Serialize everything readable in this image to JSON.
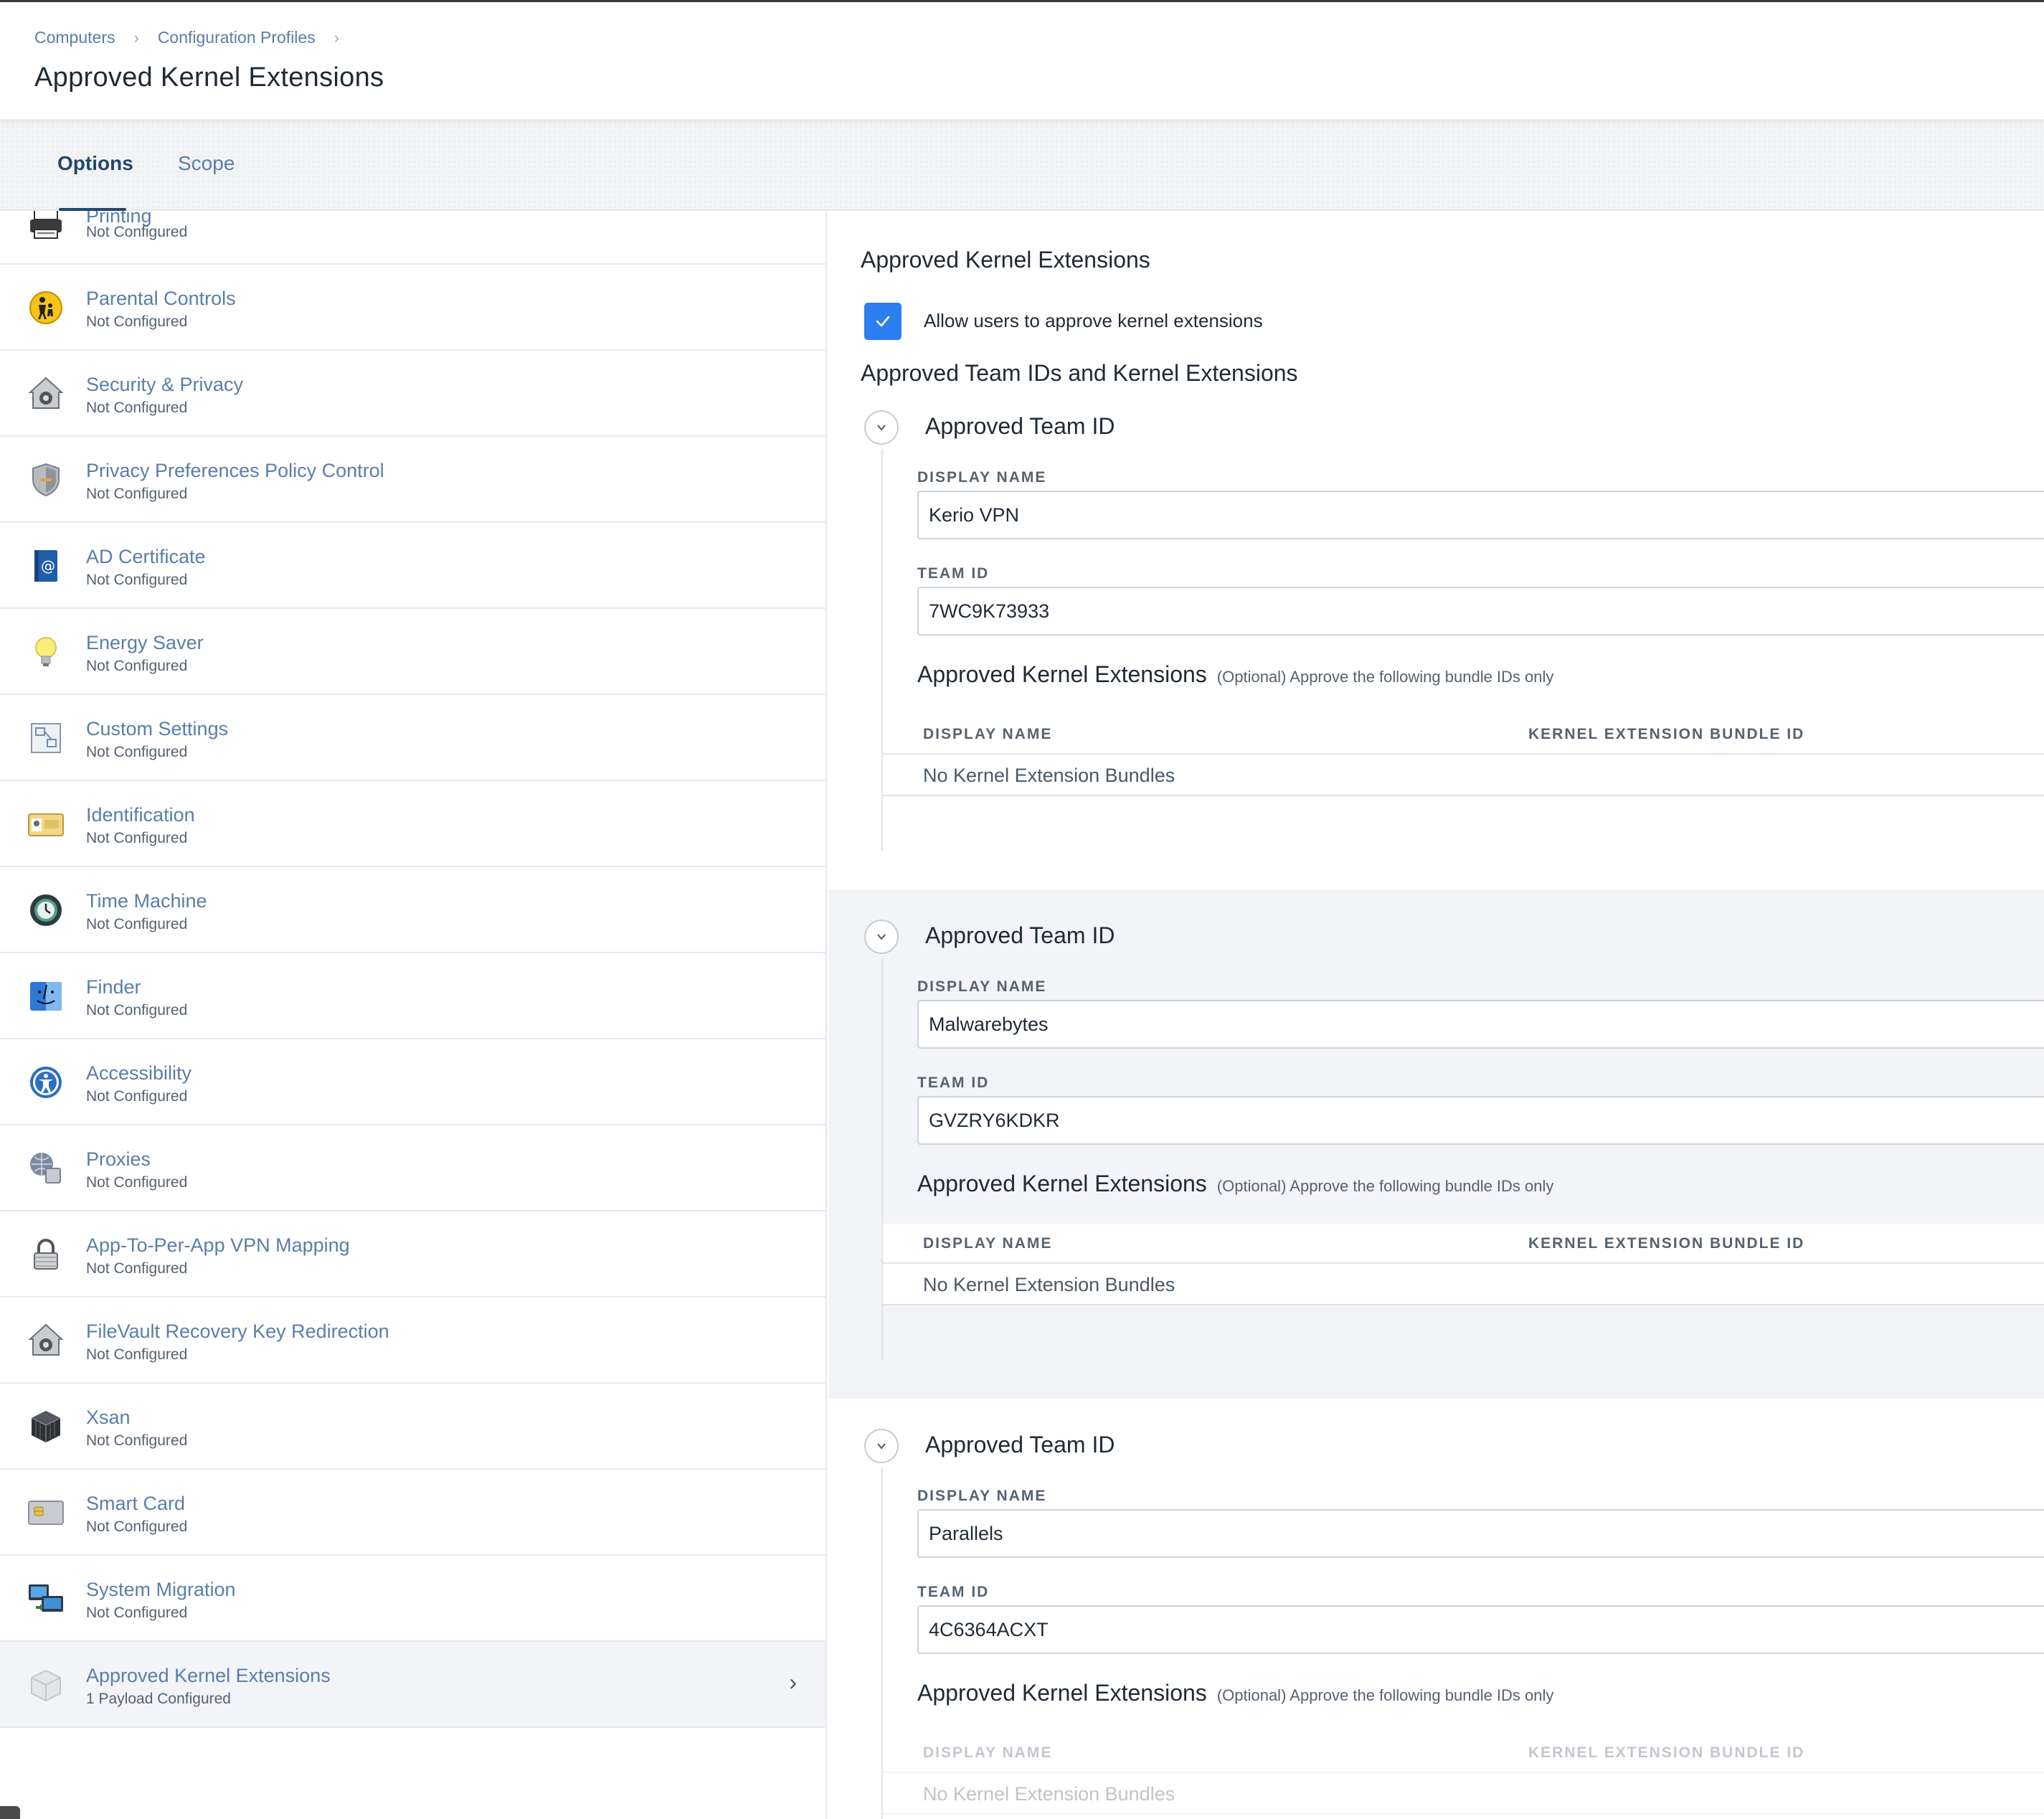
{
  "breadcrumb": {
    "items": [
      "Computers",
      "Configuration Profiles"
    ],
    "separator": "›"
  },
  "page": {
    "title": "Approved Kernel Extensions"
  },
  "tabs": [
    {
      "label": "Options",
      "active": true
    },
    {
      "label": "Scope",
      "active": false
    }
  ],
  "sidebar": {
    "items": [
      {
        "title": "Printing",
        "status": "Not Configured",
        "icon": "printer-icon"
      },
      {
        "title": "Parental Controls",
        "status": "Not Configured",
        "icon": "parental-controls-icon"
      },
      {
        "title": "Security & Privacy",
        "status": "Not Configured",
        "icon": "security-privacy-icon"
      },
      {
        "title": "Privacy Preferences Policy Control",
        "status": "Not Configured",
        "icon": "shield-icon"
      },
      {
        "title": "AD Certificate",
        "status": "Not Configured",
        "icon": "ad-certificate-icon"
      },
      {
        "title": "Energy Saver",
        "status": "Not Configured",
        "icon": "lightbulb-icon"
      },
      {
        "title": "Custom Settings",
        "status": "Not Configured",
        "icon": "custom-settings-icon"
      },
      {
        "title": "Identification",
        "status": "Not Configured",
        "icon": "id-card-icon"
      },
      {
        "title": "Time Machine",
        "status": "Not Configured",
        "icon": "time-machine-icon"
      },
      {
        "title": "Finder",
        "status": "Not Configured",
        "icon": "finder-icon"
      },
      {
        "title": "Accessibility",
        "status": "Not Configured",
        "icon": "accessibility-icon"
      },
      {
        "title": "Proxies",
        "status": "Not Configured",
        "icon": "proxies-globe-icon"
      },
      {
        "title": "App-To-Per-App VPN Mapping",
        "status": "Not Configured",
        "icon": "lock-icon"
      },
      {
        "title": "FileVault Recovery Key Redirection",
        "status": "Not Configured",
        "icon": "filevault-icon"
      },
      {
        "title": "Xsan",
        "status": "Not Configured",
        "icon": "xsan-cube-icon"
      },
      {
        "title": "Smart Card",
        "status": "Not Configured",
        "icon": "smart-card-icon"
      },
      {
        "title": "System Migration",
        "status": "Not Configured",
        "icon": "system-migration-icon"
      },
      {
        "title": "Approved Kernel Extensions",
        "status": "1 Payload Configured",
        "icon": "kernel-extension-icon",
        "selected": true
      }
    ]
  },
  "content": {
    "section_title": "Approved Kernel Extensions",
    "allow_checkbox": {
      "label": "Allow users to approve kernel extensions",
      "checked": true
    },
    "teams_title": "Approved Team IDs and Kernel Extensions",
    "teams": [
      {
        "header": "Approved Team ID",
        "display_name_label": "DISPLAY NAME",
        "display_name": "Kerio VPN",
        "team_id_label": "TEAM ID",
        "team_id": "7WC9K73933",
        "kext_title": "Approved Kernel Extensions",
        "kext_optional": "(Optional) Approve the following bundle IDs only",
        "col_display_name": "DISPLAY NAME",
        "col_bundle_id": "KERNEL EXTENSION BUNDLE ID",
        "empty_text": "No Kernel Extension Bundles"
      },
      {
        "header": "Approved Team ID",
        "display_name_label": "DISPLAY NAME",
        "display_name": "Malwarebytes",
        "team_id_label": "TEAM ID",
        "team_id": "GVZRY6KDKR",
        "kext_title": "Approved Kernel Extensions",
        "kext_optional": "(Optional) Approve the following bundle IDs only",
        "col_display_name": "DISPLAY NAME",
        "col_bundle_id": "KERNEL EXTENSION BUNDLE ID",
        "empty_text": "No Kernel Extension Bundles"
      },
      {
        "header": "Approved Team ID",
        "display_name_label": "DISPLAY NAME",
        "display_name": "Parallels",
        "team_id_label": "TEAM ID",
        "team_id": "4C6364ACXT",
        "kext_title": "Approved Kernel Extensions",
        "kext_optional": "(Optional) Approve the following bundle IDs only",
        "col_display_name": "DISPLAY NAME",
        "col_bundle_id": "KERNEL EXTENSION BUNDLE ID",
        "empty_text": "No Kernel Extension Bundles"
      }
    ]
  },
  "colors": {
    "link": "#5a7ea8",
    "active_tab": "#24466e",
    "checkbox": "#2d7ef0",
    "text": "#1f2a36",
    "muted": "#556270",
    "shaded_bg": "#f2f4f7",
    "divider": "#e6e9ed"
  }
}
